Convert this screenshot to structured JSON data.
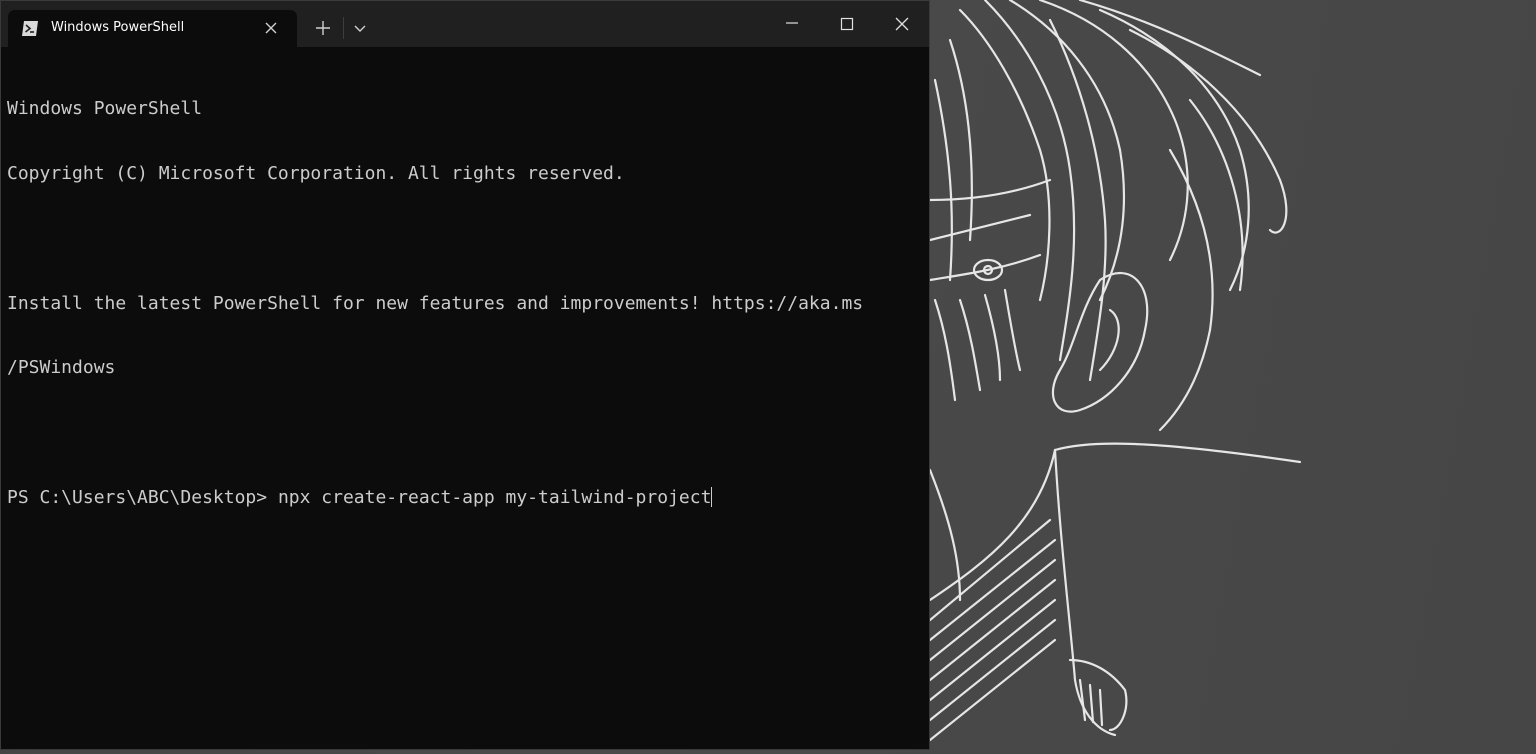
{
  "window": {
    "tab_title": "Windows PowerShell",
    "tab_icon": "powershell-icon",
    "controls": {
      "new_tab_icon": "plus-icon",
      "dropdown_icon": "chevron-down-icon",
      "minimize_icon": "minimize-icon",
      "maximize_icon": "maximize-icon",
      "close_icon": "close-icon"
    }
  },
  "terminal": {
    "lines": [
      "Windows PowerShell",
      "Copyright (C) Microsoft Corporation. All rights reserved.",
      "",
      "Install the latest PowerShell for new features and improvements! https://aka.ms",
      "/PSWindows",
      ""
    ],
    "prompt": "PS C:\\Users\\ABC\\Desktop> ",
    "command": "npx create-react-app my-tailwind-project"
  },
  "colors": {
    "terminal_bg": "#0c0c0c",
    "terminal_fg": "#cccccc",
    "titlebar_bg": "#202020",
    "desktop_bg": "#4a4a4a"
  }
}
